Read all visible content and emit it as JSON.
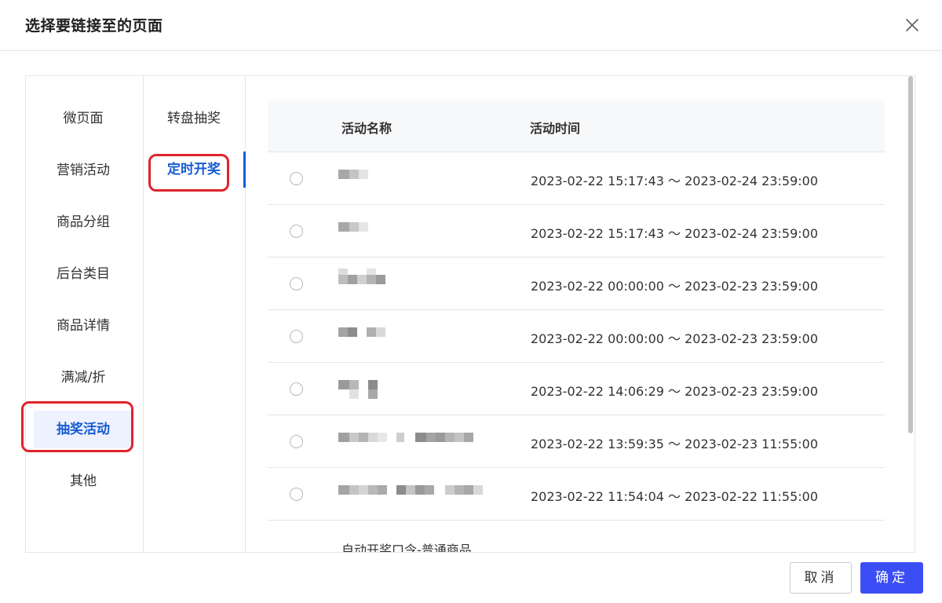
{
  "dialog": {
    "title": "选择要链接至的页面",
    "close_icon": "close-icon"
  },
  "categories": [
    {
      "label": "微页面",
      "active": false
    },
    {
      "label": "营销活动",
      "active": false
    },
    {
      "label": "商品分组",
      "active": false
    },
    {
      "label": "后台类目",
      "active": false
    },
    {
      "label": "商品详情",
      "active": false
    },
    {
      "label": "满减/折",
      "active": false
    },
    {
      "label": "抽奖活动",
      "active": true
    },
    {
      "label": "其他",
      "active": false
    }
  ],
  "subcategories": [
    {
      "label": "转盘抽奖",
      "active": false
    },
    {
      "label": "定时开奖",
      "active": true
    }
  ],
  "table": {
    "headers": {
      "name": "活动名称",
      "time": "活动时间"
    },
    "rows": [
      {
        "name": "",
        "time": "2023-02-22 15:17:43 ～ 2023-02-24 23:59:00"
      },
      {
        "name": "",
        "time": "2023-02-22 15:17:43 ～ 2023-02-24 23:59:00"
      },
      {
        "name": "",
        "time": "2023-02-22 00:00:00 ～ 2023-02-23 23:59:00"
      },
      {
        "name": "",
        "time": "2023-02-22 00:00:00 ～ 2023-02-23 23:59:00"
      },
      {
        "name": "",
        "time": "2023-02-22 14:06:29 ～ 2023-02-23 23:59:00"
      },
      {
        "name": "",
        "time": "2023-02-22 13:59:35 ～ 2023-02-23 11:55:00"
      },
      {
        "name": "",
        "time": "2023-02-22 11:54:04 ～ 2023-02-22 11:55:00"
      }
    ],
    "partial_row_name": "自动开奖口令-普通商品"
  },
  "buttons": {
    "cancel": "取消",
    "ok": "确定"
  },
  "colors": {
    "accent": "#155bd4",
    "primary_button": "#3b4ef5",
    "highlight": "#e0232b"
  }
}
